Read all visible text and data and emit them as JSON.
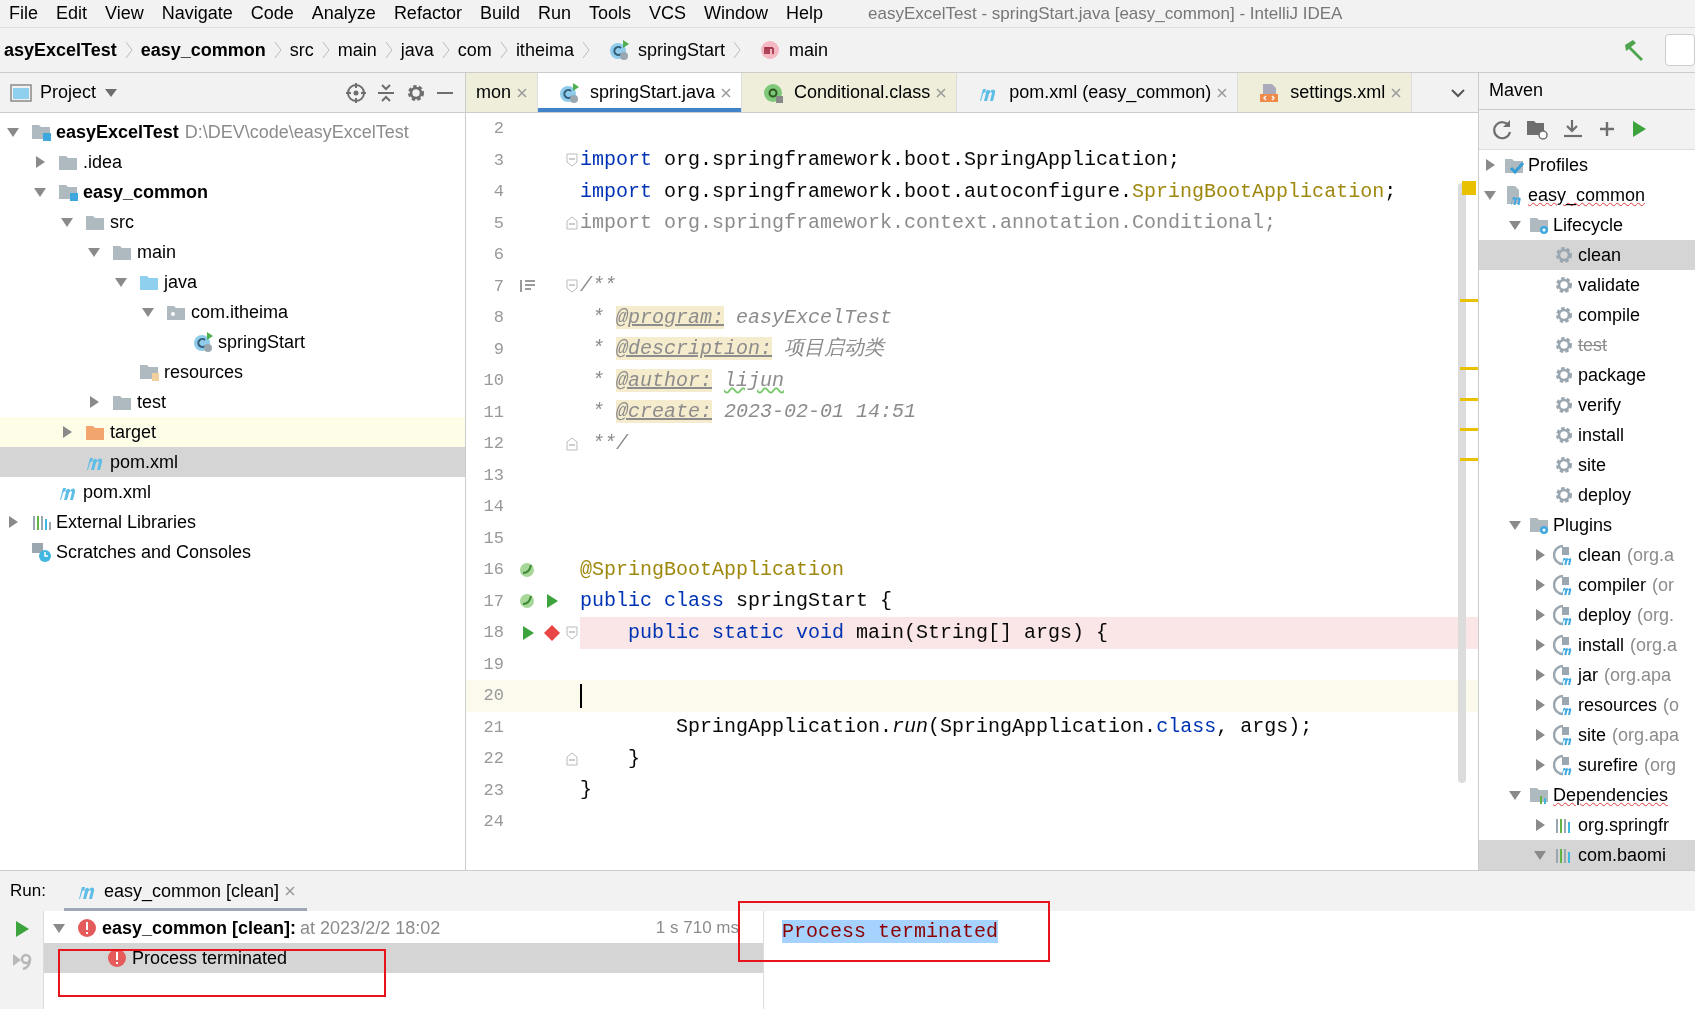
{
  "menu": [
    "File",
    "Edit",
    "View",
    "Navigate",
    "Code",
    "Analyze",
    "Refactor",
    "Build",
    "Run",
    "Tools",
    "VCS",
    "Window",
    "Help"
  ],
  "window_title": "easyExcelTest - springStart.java [easy_common] - IntelliJ IDEA",
  "breadcrumbs": [
    {
      "label": "asyExcelTest",
      "bold": true,
      "kind": "dir"
    },
    {
      "label": "easy_common",
      "bold": true,
      "kind": "dir"
    },
    {
      "label": "src",
      "bold": false,
      "kind": "dir"
    },
    {
      "label": "main",
      "bold": false,
      "kind": "dir"
    },
    {
      "label": "java",
      "bold": false,
      "kind": "dir"
    },
    {
      "label": "com",
      "bold": false,
      "kind": "dir"
    },
    {
      "label": "itheima",
      "bold": false,
      "kind": "dir"
    },
    {
      "label": "springStart",
      "bold": false,
      "kind": "class"
    },
    {
      "label": "main",
      "bold": false,
      "kind": "method"
    }
  ],
  "project": {
    "title": "Project",
    "tree": [
      {
        "label": "easyExcelTest",
        "detail": "D:\\DEV\\code\\easyExcelTest",
        "kind": "module",
        "bold": true,
        "expanded": true,
        "selected": false,
        "highlighted": false,
        "children": [
          {
            "label": ".idea",
            "kind": "folder",
            "bold": false,
            "expanded": false,
            "selected": false,
            "highlighted": false
          },
          {
            "label": "easy_common",
            "kind": "module",
            "bold": true,
            "expanded": true,
            "selected": false,
            "highlighted": false,
            "children": [
              {
                "label": "src",
                "kind": "folder",
                "bold": false,
                "expanded": true,
                "selected": false,
                "highlighted": false,
                "children": [
                  {
                    "label": "main",
                    "kind": "folder",
                    "bold": false,
                    "expanded": true,
                    "selected": false,
                    "highlighted": false,
                    "children": [
                      {
                        "label": "java",
                        "kind": "source",
                        "bold": false,
                        "expanded": true,
                        "selected": false,
                        "highlighted": false,
                        "children": [
                          {
                            "label": "com.itheima",
                            "kind": "package",
                            "bold": false,
                            "expanded": true,
                            "selected": false,
                            "highlighted": false,
                            "children": [
                              {
                                "label": "springStart",
                                "kind": "class",
                                "bold": false,
                                "selected": false,
                                "highlighted": false
                              }
                            ]
                          }
                        ]
                      },
                      {
                        "label": "resources",
                        "kind": "resources",
                        "bold": false,
                        "selected": false,
                        "highlighted": false
                      }
                    ]
                  },
                  {
                    "label": "test",
                    "kind": "folder",
                    "bold": false,
                    "expanded": false,
                    "selected": false,
                    "highlighted": false
                  }
                ]
              },
              {
                "label": "target",
                "kind": "excluded",
                "bold": false,
                "expanded": false,
                "selected": false,
                "highlighted": true
              },
              {
                "label": "pom.xml",
                "kind": "maven",
                "bold": false,
                "selected": true,
                "highlighted": false
              }
            ]
          },
          {
            "label": "pom.xml",
            "kind": "maven",
            "bold": false,
            "selected": false,
            "highlighted": false
          }
        ]
      },
      {
        "label": "External Libraries",
        "kind": "libraries",
        "bold": false,
        "expanded": false,
        "selected": false,
        "highlighted": false
      },
      {
        "label": "Scratches and Consoles",
        "kind": "scratches",
        "bold": false,
        "selected": false,
        "highlighted": false
      }
    ]
  },
  "editor": {
    "tabs": [
      {
        "label": "mon",
        "kind": "none",
        "tinted": true,
        "selected": false
      },
      {
        "label": "springStart.java",
        "kind": "class",
        "tinted": false,
        "selected": true
      },
      {
        "label": "Conditional.class",
        "kind": "annotation",
        "tinted": true,
        "selected": false
      },
      {
        "label": "pom.xml (easy_common)",
        "kind": "maven",
        "tinted": false,
        "selected": false
      },
      {
        "label": "settings.xml",
        "kind": "xml",
        "tinted": true,
        "selected": false
      }
    ],
    "lines": [
      {
        "number": "2",
        "kind": "plain"
      },
      {
        "number": "3",
        "kind": "plain",
        "gutter": [
          {
            "kind": "fold-start"
          }
        ],
        "tokens": [
          {
            "kind": "keyword",
            "text": "import"
          },
          {
            "kind": "plain",
            "text": " org.springframework.boot.SpringApplication;"
          }
        ]
      },
      {
        "number": "4",
        "kind": "plain",
        "tokens": [
          {
            "kind": "keyword",
            "text": "import"
          },
          {
            "kind": "plain",
            "text": " org.springframework.boot.autoconfigure."
          },
          {
            "kind": "annotation",
            "text": "SpringBootApplication"
          },
          {
            "kind": "plain",
            "text": ";"
          }
        ]
      },
      {
        "number": "5",
        "kind": "plain",
        "gutter": [
          {
            "kind": "fold-end"
          }
        ],
        "tokens": [
          {
            "kind": "unused",
            "text": "import org.springframework.context.annotation.Conditional;"
          }
        ]
      },
      {
        "number": "6",
        "kind": "plain"
      },
      {
        "number": "7",
        "kind": "plain",
        "gutter": [
          {
            "kind": "doc-toggle"
          },
          {
            "kind": "fold-start"
          }
        ],
        "tokens": [
          {
            "kind": "doc",
            "text": "/**"
          }
        ]
      },
      {
        "number": "8",
        "kind": "plain",
        "tokens": [
          {
            "kind": "doc",
            "text": " * "
          },
          {
            "kind": "doc-tag",
            "text": "@program:"
          },
          {
            "kind": "doc",
            "text": " easyExcelTest"
          }
        ]
      },
      {
        "number": "9",
        "kind": "plain",
        "tokens": [
          {
            "kind": "doc",
            "text": " * "
          },
          {
            "kind": "doc-tag",
            "text": "@description:"
          },
          {
            "kind": "doc",
            "text": " 项目启动类"
          }
        ]
      },
      {
        "number": "10",
        "kind": "plain",
        "tokens": [
          {
            "kind": "doc",
            "text": " * "
          },
          {
            "kind": "doc-tag",
            "text": "@author:"
          },
          {
            "kind": "doc-typo",
            "text": "lijun"
          }
        ]
      },
      {
        "number": "11",
        "kind": "plain",
        "tokens": [
          {
            "kind": "doc",
            "text": " * "
          },
          {
            "kind": "doc-tag",
            "text": "@create:"
          },
          {
            "kind": "doc",
            "text": " 2023-02-01 14:51"
          }
        ]
      },
      {
        "number": "12",
        "kind": "plain",
        "gutter": [
          {
            "kind": "fold-end"
          }
        ],
        "tokens": [
          {
            "kind": "doc",
            "text": " **/"
          }
        ]
      },
      {
        "number": "13",
        "kind": "plain"
      },
      {
        "number": "14",
        "kind": "plain"
      },
      {
        "number": "15",
        "kind": "plain"
      },
      {
        "number": "16",
        "kind": "plain",
        "gutter": [
          {
            "kind": "bean"
          }
        ],
        "tokens": [
          {
            "kind": "annotation",
            "text": "@SpringBootApplication"
          }
        ]
      },
      {
        "number": "17",
        "kind": "plain",
        "gutter": [
          {
            "kind": "bean"
          },
          {
            "kind": "run"
          }
        ],
        "tokens": [
          {
            "kind": "keyword",
            "text": "public class"
          },
          {
            "kind": "plain",
            "text": " springStart {"
          }
        ]
      },
      {
        "number": "18",
        "kind": "breakpoint",
        "gutter": [
          {
            "kind": "run"
          },
          {
            "kind": "breakpoint"
          },
          {
            "kind": "fold-start"
          }
        ],
        "tokens": [
          {
            "kind": "keyword",
            "text": "    public static void"
          },
          {
            "kind": "plain",
            "text": " main(String[] args) {"
          }
        ]
      },
      {
        "number": "19",
        "kind": "plain"
      },
      {
        "number": "20",
        "kind": "caret"
      },
      {
        "number": "21",
        "kind": "plain",
        "tokens": [
          {
            "kind": "plain",
            "text": "        SpringApplication."
          },
          {
            "kind": "static-call",
            "text": "run"
          },
          {
            "kind": "plain",
            "text": "(SpringApplication."
          },
          {
            "kind": "keyword",
            "text": "class"
          },
          {
            "kind": "plain",
            "text": ", args);"
          }
        ]
      },
      {
        "number": "22",
        "kind": "plain",
        "gutter": [
          {
            "kind": "fold-end"
          }
        ],
        "tokens": [
          {
            "kind": "plain",
            "text": "    }"
          }
        ]
      },
      {
        "number": "23",
        "kind": "plain",
        "tokens": [
          {
            "kind": "plain",
            "text": "}"
          }
        ]
      },
      {
        "number": "24",
        "kind": "plain"
      }
    ]
  },
  "maven": {
    "title": "Maven",
    "tree": [
      {
        "label": "Profiles",
        "kind": "profiles",
        "expanded": false,
        "selected": false,
        "misspelled": false
      },
      {
        "label": "easy_common",
        "kind": "maven-module",
        "expanded": true,
        "selected": false,
        "misspelled": true,
        "children": [
          {
            "label": "Lifecycle",
            "kind": "config-folder",
            "expanded": true,
            "selected": false,
            "misspelled": false,
            "children": [
              {
                "label": "clean",
                "kind": "goal",
                "selected": true,
                "skipped": false
              },
              {
                "label": "validate",
                "kind": "goal",
                "selected": false,
                "skipped": false
              },
              {
                "label": "compile",
                "kind": "goal",
                "selected": false,
                "skipped": false
              },
              {
                "label": "test",
                "kind": "goal",
                "selected": false,
                "skipped": true
              },
              {
                "label": "package",
                "kind": "goal",
                "selected": false,
                "skipped": false
              },
              {
                "label": "verify",
                "kind": "goal",
                "selected": false,
                "skipped": false
              },
              {
                "label": "install",
                "kind": "goal",
                "selected": false,
                "skipped": false
              },
              {
                "label": "site",
                "kind": "goal",
                "selected": false,
                "skipped": false
              },
              {
                "label": "deploy",
                "kind": "goal",
                "selected": false,
                "skipped": false
              }
            ]
          },
          {
            "label": "Plugins",
            "kind": "config-folder",
            "expanded": true,
            "selected": false,
            "misspelled": false,
            "children": [
              {
                "label": "clean",
                "detail": "(org.a",
                "kind": "plugin",
                "expanded": false,
                "selected": false
              },
              {
                "label": "compiler",
                "detail": "(or",
                "kind": "plugin",
                "expanded": false,
                "selected": false
              },
              {
                "label": "deploy",
                "detail": "(org.",
                "kind": "plugin",
                "expanded": false,
                "selected": false
              },
              {
                "label": "install",
                "detail": "(org.a",
                "kind": "plugin",
                "expanded": false,
                "selected": false
              },
              {
                "label": "jar",
                "detail": "(org.apa",
                "kind": "plugin",
                "expanded": false,
                "selected": false
              },
              {
                "label": "resources",
                "detail": "(o",
                "kind": "plugin",
                "expanded": false,
                "selected": false
              },
              {
                "label": "site",
                "detail": "(org.apa",
                "kind": "plugin",
                "expanded": false,
                "selected": false
              },
              {
                "label": "surefire",
                "detail": "(org",
                "kind": "plugin",
                "expanded": false,
                "selected": false
              }
            ]
          },
          {
            "label": "Dependencies",
            "kind": "deps-folder",
            "expanded": true,
            "selected": false,
            "misspelled": true,
            "children": [
              {
                "label": "org.springfr",
                "kind": "library",
                "expanded": false,
                "selected": false
              },
              {
                "label": "com.baomi",
                "kind": "library",
                "expanded": true,
                "selected": true
              }
            ]
          }
        ]
      }
    ]
  },
  "run": {
    "label": "Run:",
    "tabs": [
      {
        "label": "easy_common [clean]",
        "selected": true
      }
    ],
    "tree": [
      {
        "label": "easy_common [clean]:",
        "detail": "at 2023/2/2 18:02",
        "time": "1 s 710 ms",
        "kind": "error",
        "bold": true,
        "expanded": true,
        "selected": false,
        "children": [
          {
            "label": "Process terminated",
            "kind": "error",
            "bold": false,
            "selected": true
          }
        ]
      }
    ],
    "console": {
      "text": "Process terminated",
      "selected": true
    }
  }
}
